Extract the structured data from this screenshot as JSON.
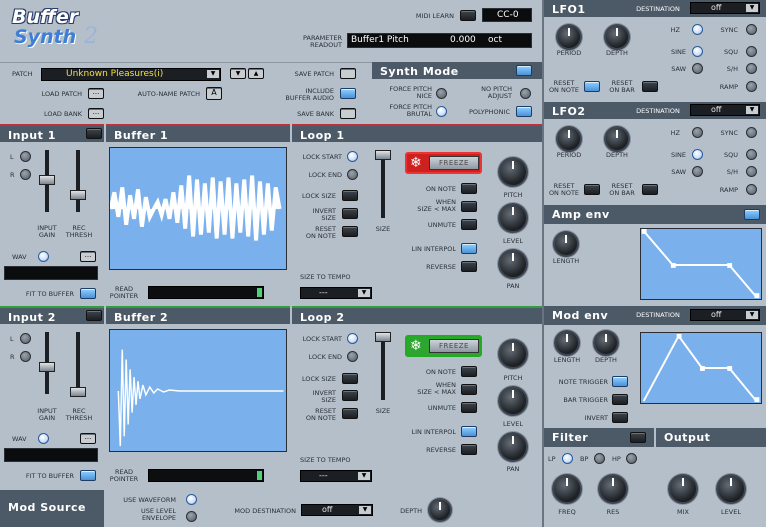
{
  "logo": {
    "line1": "Buffer",
    "line2": "Synth",
    "num": "2"
  },
  "midi": {
    "learn_label": "MIDI LEARN",
    "cc_value": "CC-0"
  },
  "param": {
    "label_line1": "PARAMETER",
    "label_line2": "READOUT",
    "name": "Buffer1 Pitch",
    "value": "0.000",
    "unit": "oct"
  },
  "patch": {
    "label": "PATCH",
    "value": "Unknown Pleasures(i)",
    "load_patch": "LOAD PATCH",
    "auto_name": "AUTO-NAME PATCH",
    "auto_name_btn": "A",
    "load_bank": "LOAD BANK",
    "save_patch": "SAVE PATCH",
    "include_line1": "INCLUDE",
    "include_line2": "BUFFER AUDIO",
    "save_bank": "SAVE BANK",
    "dots": "..."
  },
  "synth_mode": {
    "title": "Synth Mode",
    "force_nice_1": "FORCE PITCH",
    "force_nice_2": "NICE",
    "force_brutal_1": "FORCE PITCH",
    "force_brutal_2": "BRUTAL",
    "no_pitch_1": "NO PITCH",
    "no_pitch_2": "ADJUST",
    "polyphonic": "POLYPHONIC"
  },
  "input1": {
    "title": "Input 1",
    "l": "L",
    "r": "R",
    "gain_1": "INPUT",
    "gain_2": "GAIN",
    "rec_1": "REC",
    "rec_2": "THRESH",
    "wav": "WAV",
    "dots": "...",
    "fit": "FIT TO BUFFER"
  },
  "input2": {
    "title": "Input 2",
    "l": "L",
    "r": "R",
    "gain_1": "INPUT",
    "gain_2": "GAIN",
    "rec_1": "REC",
    "rec_2": "THRESH",
    "wav": "WAV",
    "dots": "...",
    "fit": "FIT TO BUFFER"
  },
  "buffer1": {
    "title": "Buffer 1",
    "read_1": "READ",
    "read_2": "POINTER"
  },
  "buffer2": {
    "title": "Buffer 2",
    "read_1": "READ",
    "read_2": "POINTER"
  },
  "loop1": {
    "title": "Loop 1",
    "lock_start": "LOCK START",
    "lock_end": "LOCK END",
    "lock_size": "LOCK SIZE",
    "invert_1": "INVERT",
    "invert_2": "SIZE",
    "reset_1": "RESET",
    "reset_2": "ON NOTE",
    "size": "SIZE",
    "size_tempo": "SIZE TO TEMPO",
    "tempo_val": "---",
    "freeze": "FREEZE",
    "on_note": "ON NOTE",
    "when_1": "WHEN",
    "when_2": "SIZE < MAX",
    "unmute": "UNMUTE",
    "lin": "LIN INTERPOL",
    "reverse": "REVERSE",
    "pitch": "PITCH",
    "level": "LEVEL",
    "pan": "PAN"
  },
  "loop2": {
    "title": "Loop 2",
    "lock_start": "LOCK START",
    "lock_end": "LOCK END",
    "lock_size": "LOCK SIZE",
    "invert_1": "INVERT",
    "invert_2": "SIZE",
    "reset_1": "RESET",
    "reset_2": "ON NOTE",
    "size": "SIZE",
    "size_tempo": "SIZE TO TEMPO",
    "tempo_val": "---",
    "freeze": "FREEZE",
    "on_note": "ON NOTE",
    "when_1": "WHEN",
    "when_2": "SIZE < MAX",
    "unmute": "UNMUTE",
    "lin": "LIN INTERPOL",
    "reverse": "REVERSE",
    "pitch": "PITCH",
    "level": "LEVEL",
    "pan": "PAN"
  },
  "mod_source": {
    "title": "Mod Source",
    "use_wave": "USE WAVEFORM",
    "use_level_1": "USE LEVEL",
    "use_level_2": "ENVELOPE",
    "dest_label": "MOD DESTINATION",
    "dest_val": "off",
    "depth": "DEPTH"
  },
  "lfo1": {
    "title": "LFO1",
    "dest_label": "DESTINATION",
    "dest_val": "off",
    "period": "PERIOD",
    "depth": "DEPTH",
    "hz": "HZ",
    "sync": "SYNC",
    "sine": "SINE",
    "squ": "SQU",
    "saw": "SAW",
    "sh": "S/H",
    "ramp": "RAMP",
    "reset_note_1": "RESET",
    "reset_note_2": "ON NOTE",
    "reset_bar_1": "RESET",
    "reset_bar_2": "ON BAR"
  },
  "lfo2": {
    "title": "LFO2",
    "dest_label": "DESTINATION",
    "dest_val": "off",
    "period": "PERIOD",
    "depth": "DEPTH",
    "hz": "HZ",
    "sync": "SYNC",
    "sine": "SINE",
    "squ": "SQU",
    "saw": "SAW",
    "sh": "S/H",
    "ramp": "RAMP",
    "reset_note_1": "RESET",
    "reset_note_2": "ON NOTE",
    "reset_bar_1": "RESET",
    "reset_bar_2": "ON BAR"
  },
  "amp_env": {
    "title": "Amp env",
    "length": "LENGTH"
  },
  "mod_env": {
    "title": "Mod env",
    "dest_label": "DESTINATION",
    "dest_val": "off",
    "length": "LENGTH",
    "depth": "DEPTH",
    "note_trig": "NOTE TRIGGER",
    "bar_trig": "BAR TRIGGER",
    "invert": "INVERT"
  },
  "filter": {
    "title": "Filter",
    "lp": "LP",
    "bp": "BP",
    "hp": "HP",
    "freq": "FREQ",
    "res": "RES"
  },
  "output": {
    "title": "Output",
    "mix": "MIX",
    "level": "LEVEL"
  }
}
